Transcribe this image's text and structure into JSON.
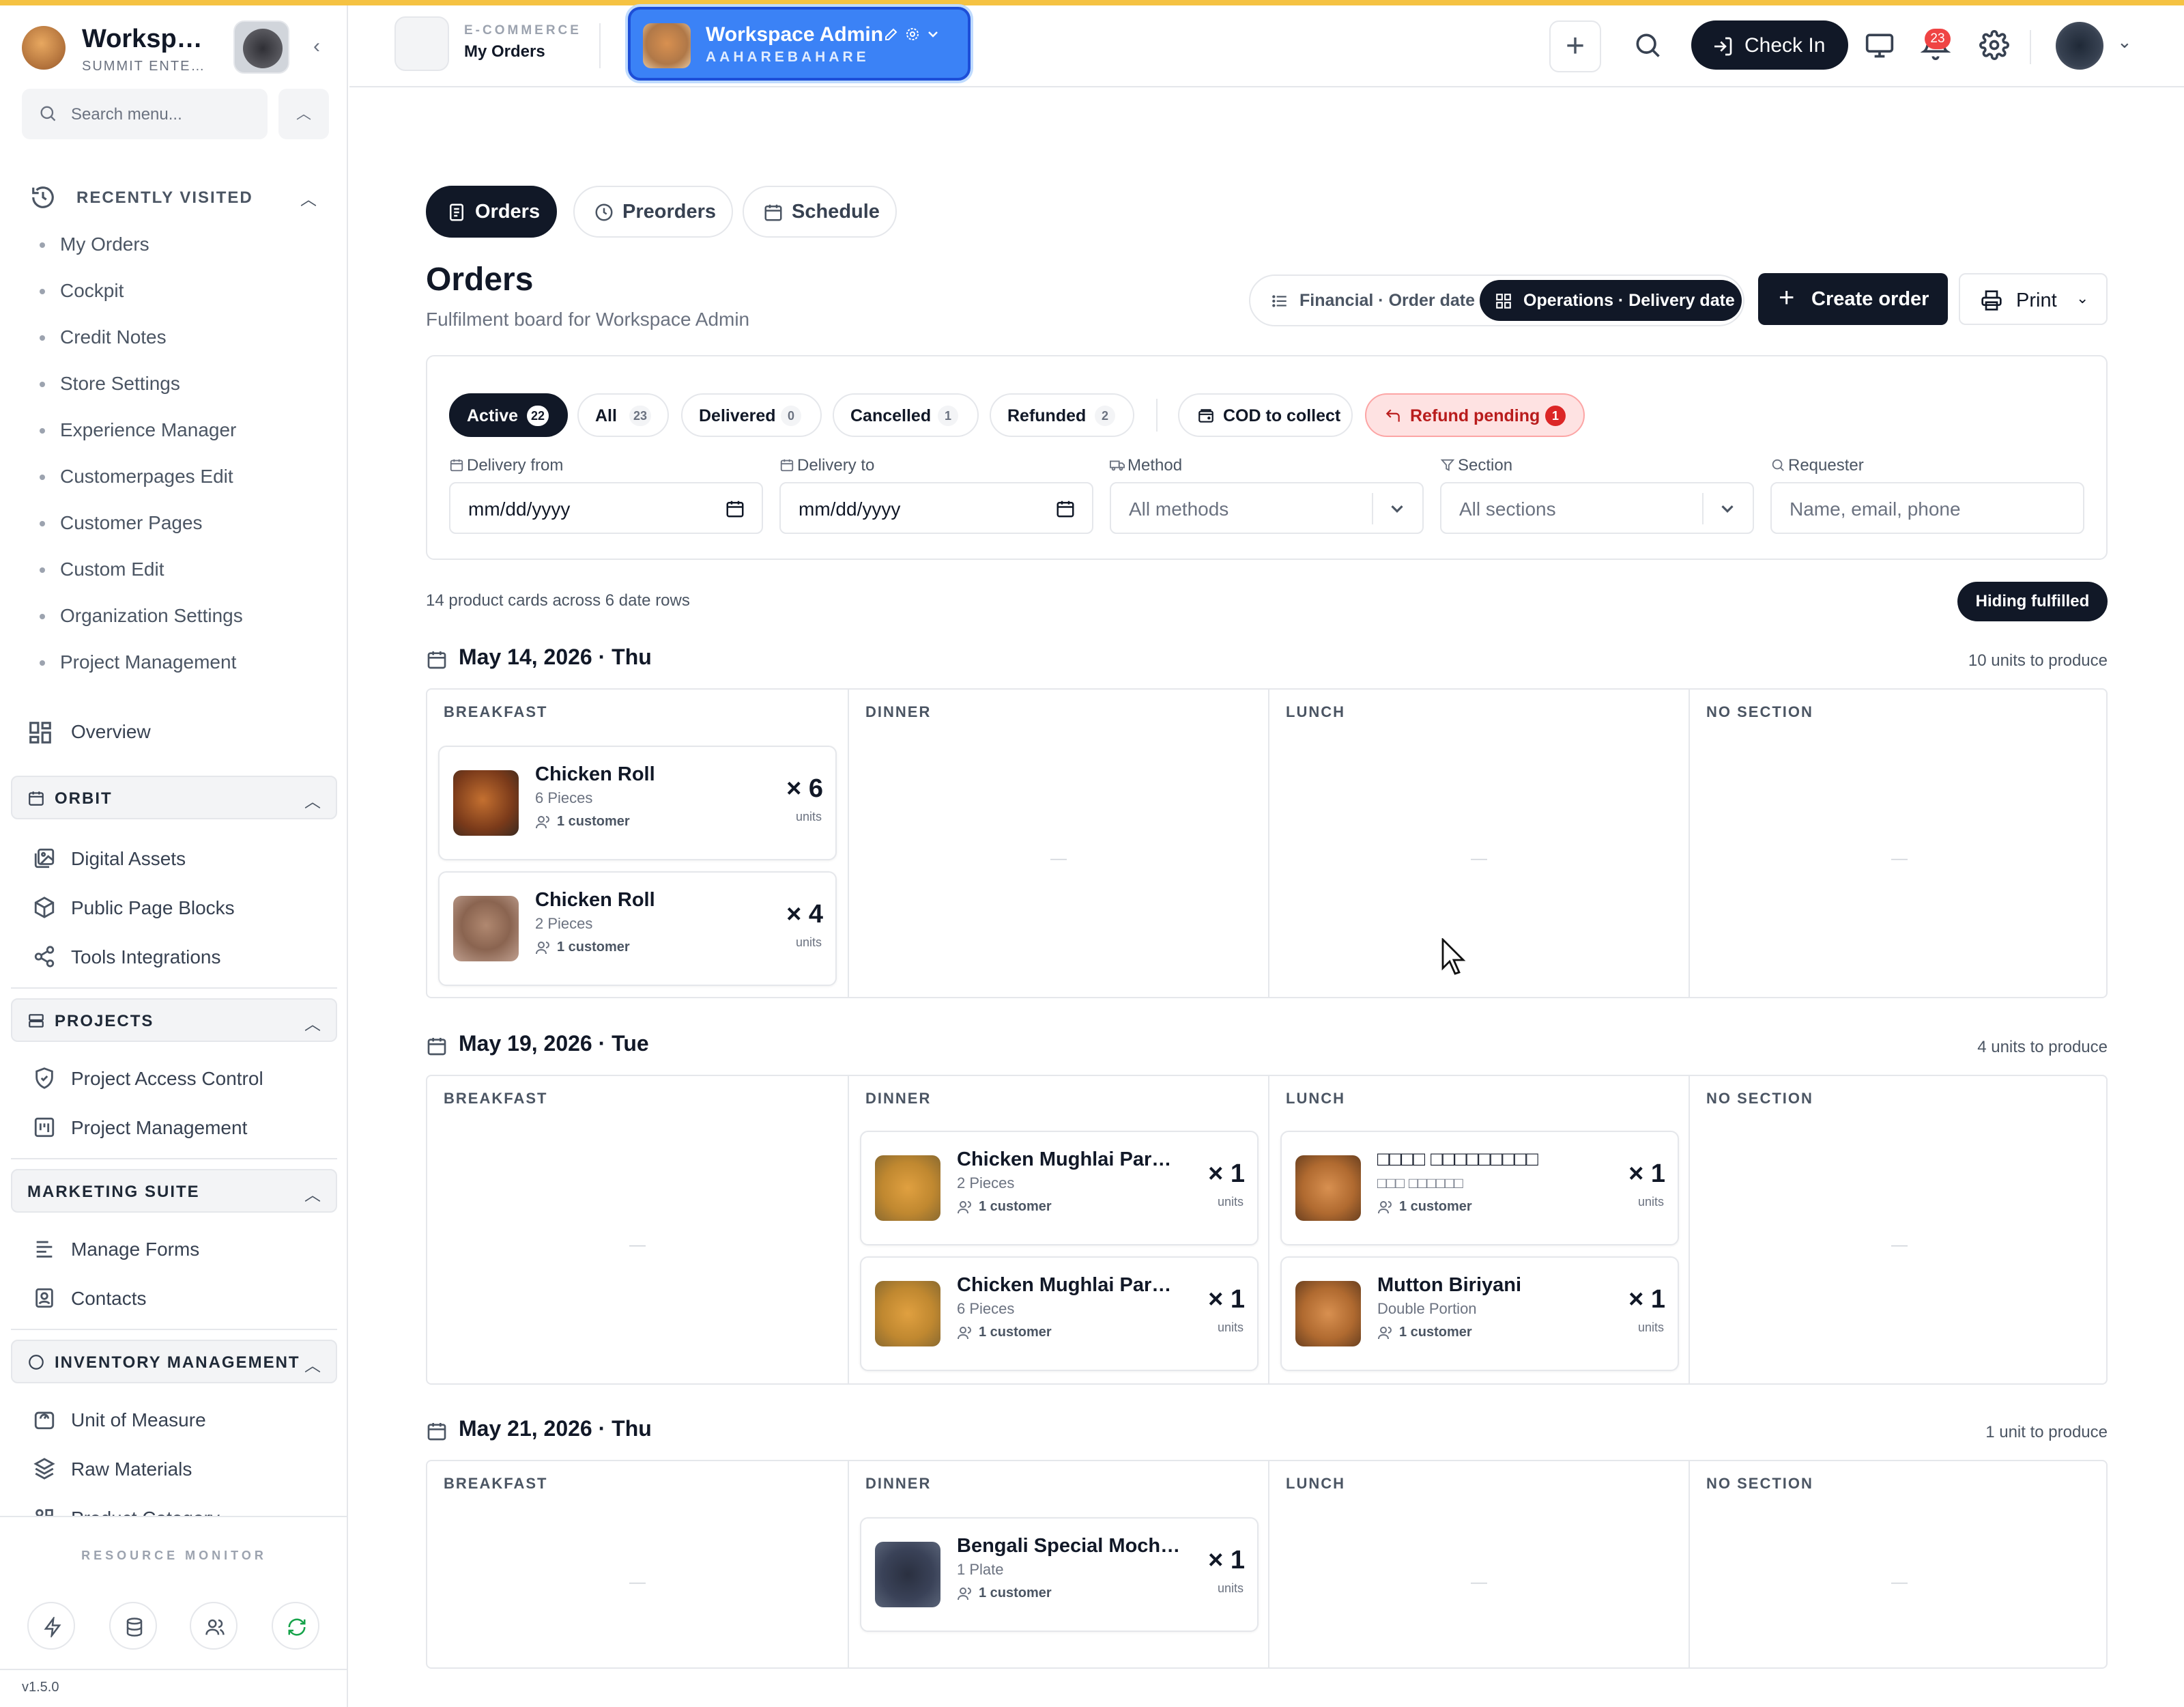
{
  "sidebar": {
    "org_name": "Worksp…",
    "org_sub": "SUMMIT ENTE…",
    "search_placeholder": "Search menu...",
    "recently_visited_label": "RECENTLY VISITED",
    "recent": [
      "My Orders",
      "Cockpit",
      "Credit Notes",
      "Store Settings",
      "Experience Manager",
      "Customerpages Edit",
      "Customer Pages",
      "Custom Edit",
      "Organization Settings",
      "Project Management"
    ],
    "overview": "Overview",
    "sections": {
      "orbit": {
        "label": "ORBIT",
        "items": [
          "Digital Assets",
          "Public Page Blocks",
          "Tools Integrations"
        ]
      },
      "projects": {
        "label": "PROJECTS",
        "items": [
          "Project Access Control",
          "Project Management"
        ]
      },
      "marketing": {
        "label": "MARKETING SUITE",
        "items": [
          "Manage Forms",
          "Contacts"
        ]
      },
      "inventory": {
        "label": "INVENTORY MANAGEMENT",
        "items": [
          "Unit of Measure",
          "Raw Materials",
          "Product Category"
        ]
      }
    },
    "resource_monitor": "RESOURCE MONITOR",
    "version": "v1.5.0"
  },
  "header": {
    "app_category": "E-COMMERCE",
    "app_name": "My Orders",
    "workspace_name": "Workspace Admin",
    "workspace_sub": "AAHAREBAHARE",
    "check_in": "Check In",
    "notifications_count": "23"
  },
  "tabs": [
    "Orders",
    "Preorders",
    "Schedule"
  ],
  "page": {
    "title": "Orders",
    "subtitle": "Fulfilment board for Workspace Admin",
    "mode_financial": "Financial · Order date",
    "mode_operations": "Operations · Delivery date",
    "create_order": "Create order",
    "print": "Print"
  },
  "filters": {
    "chips": [
      {
        "label": "Active",
        "count": "22"
      },
      {
        "label": "All",
        "count": "23"
      },
      {
        "label": "Delivered",
        "count": "0"
      },
      {
        "label": "Cancelled",
        "count": "1"
      },
      {
        "label": "Refunded",
        "count": "2"
      }
    ],
    "cod": "COD to collect",
    "refund_pending": {
      "label": "Refund pending",
      "count": "1"
    },
    "delivery_from_label": "Delivery from",
    "delivery_from_value": "mm/dd/yyyy",
    "delivery_to_label": "Delivery to",
    "delivery_to_value": "mm/dd/yyyy",
    "method_label": "Method",
    "method_value": "All methods",
    "section_label": "Section",
    "section_value": "All sections",
    "requester_label": "Requester",
    "requester_placeholder": "Name, email, phone"
  },
  "summary": "14 product cards across 6 date rows",
  "hiding_fulfilled": "Hiding fulfilled",
  "columns": [
    "BREAKFAST",
    "DINNER",
    "LUNCH",
    "NO SECTION"
  ],
  "empty_mark": "—",
  "units_label": "units",
  "rows": [
    {
      "date": "May 14, 2026 · Thu",
      "units": "10 units to produce",
      "cards": [
        {
          "name": "Chicken Roll",
          "variant": "6 Pieces",
          "customers": "1 customer",
          "qty": "× 6"
        },
        {
          "name": "Chicken Roll",
          "variant": "2 Pieces",
          "customers": "1 customer",
          "qty": "× 4"
        }
      ]
    },
    {
      "date": "May 19, 2026 · Tue",
      "units": "4 units to produce",
      "cards": [
        {
          "name": "Chicken Mughlai Paratha",
          "variant": "2 Pieces",
          "customers": "1 customer",
          "qty": "× 1"
        },
        {
          "name": "Chicken Mughlai Paratha",
          "variant": "6 Pieces",
          "customers": "1 customer",
          "qty": "× 1"
        },
        {
          "name": "□□□□ □□□□□□□□□",
          "variant": "□□□ □□□□□□",
          "customers": "1 customer",
          "qty": "× 1"
        },
        {
          "name": "Mutton Biriyani",
          "variant": "Double Portion",
          "customers": "1 customer",
          "qty": "× 1"
        }
      ]
    },
    {
      "date": "May 21, 2026 · Thu",
      "units": "1 unit to produce",
      "cards": [
        {
          "name": "Bengali Special Mocha…",
          "variant": "1 Plate",
          "customers": "1 customer",
          "qty": "× 1"
        }
      ]
    }
  ]
}
